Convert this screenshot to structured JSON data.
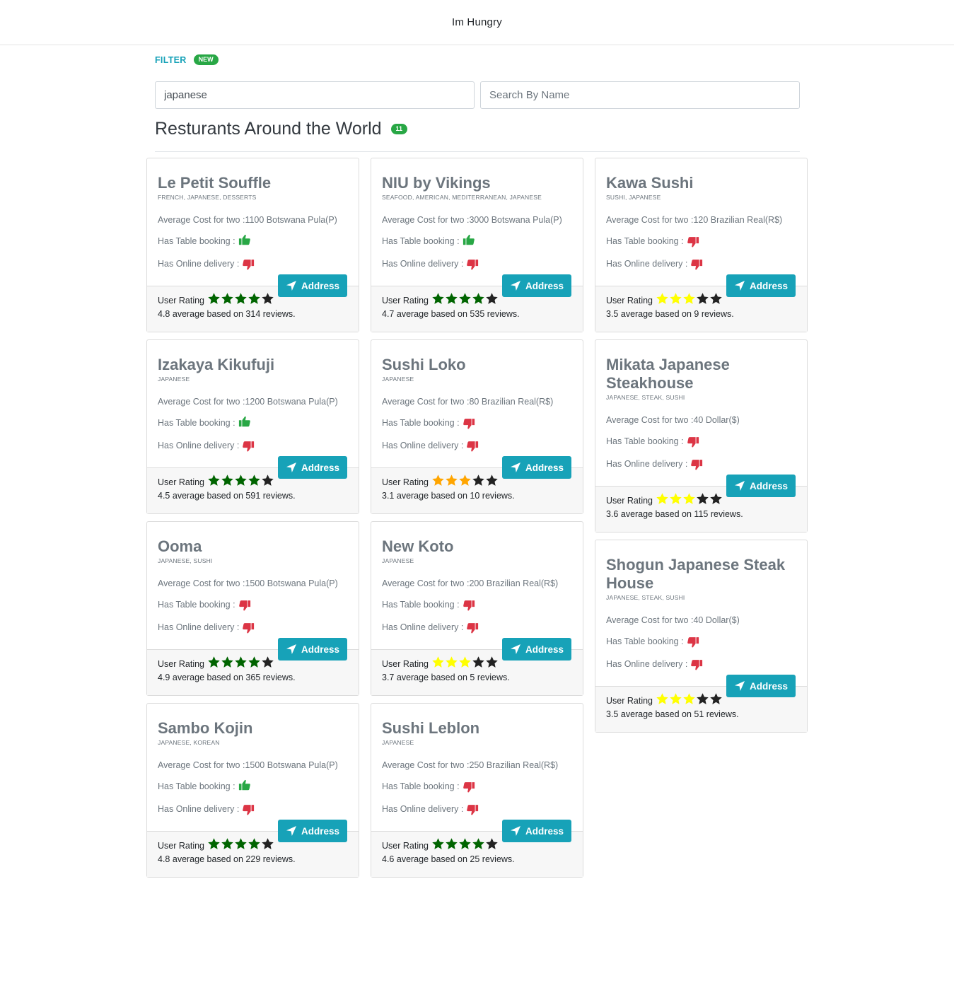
{
  "app": {
    "title": "Im Hungry"
  },
  "filter": {
    "label": "FILTER",
    "badge": "NEW"
  },
  "search": {
    "cuisine_value": "japanese",
    "name_value": "",
    "name_placeholder": "Search By Name"
  },
  "section": {
    "heading": "Resturants Around the World",
    "count": "11"
  },
  "labels": {
    "avg_cost_prefix": "Average Cost for two : ",
    "table_booking": "Has Table booking : ",
    "online_delivery": "Has Online delivery : ",
    "address_button": "Address",
    "user_rating": "User Rating",
    "rating_mid": " average based on ",
    "rating_suffix": " reviews."
  },
  "colors": {
    "accent": "#17a2b8",
    "badge_green": "#28a745",
    "thumb_up": "#28a745",
    "thumb_down": "#dc3545",
    "star_dark_green": "#006400",
    "star_green": "#228b22",
    "star_yellow": "#ffff00",
    "star_orange": "#ffa500",
    "star_empty": "#222222"
  },
  "columns": [
    [
      {
        "name": "Le Petit Souffle",
        "cuisines": "FRENCH, JAPANESE, DESSERTS",
        "cost": "1100 Botswana Pula(P)",
        "table_booking": true,
        "online_delivery": false,
        "rating": 4.8,
        "reviews": 314,
        "star_color": "star_dark_green",
        "filled_stars": 4
      },
      {
        "name": "Izakaya Kikufuji",
        "cuisines": "JAPANESE",
        "cost": "1200 Botswana Pula(P)",
        "table_booking": true,
        "online_delivery": false,
        "rating": 4.5,
        "reviews": 591,
        "star_color": "star_dark_green",
        "filled_stars": 4
      },
      {
        "name": "Ooma",
        "cuisines": "JAPANESE, SUSHI",
        "cost": "1500 Botswana Pula(P)",
        "table_booking": false,
        "online_delivery": false,
        "rating": 4.9,
        "reviews": 365,
        "star_color": "star_dark_green",
        "filled_stars": 4
      },
      {
        "name": "Sambo Kojin",
        "cuisines": "JAPANESE, KOREAN",
        "cost": "1500 Botswana Pula(P)",
        "table_booking": true,
        "online_delivery": false,
        "rating": 4.8,
        "reviews": 229,
        "star_color": "star_dark_green",
        "filled_stars": 4
      }
    ],
    [
      {
        "name": "NIU by Vikings",
        "cuisines": "SEAFOOD, AMERICAN, MEDITERRANEAN, JAPANESE",
        "cost": "3000 Botswana Pula(P)",
        "table_booking": true,
        "online_delivery": false,
        "rating": 4.7,
        "reviews": 535,
        "star_color": "star_dark_green",
        "filled_stars": 4
      },
      {
        "name": "Sushi Loko",
        "cuisines": "JAPANESE",
        "cost": "80 Brazilian Real(R$)",
        "table_booking": false,
        "online_delivery": false,
        "rating": 3.1,
        "reviews": 10,
        "star_color": "star_orange",
        "filled_stars": 3
      },
      {
        "name": "New Koto",
        "cuisines": "JAPANESE",
        "cost": "200 Brazilian Real(R$)",
        "table_booking": false,
        "online_delivery": false,
        "rating": 3.7,
        "reviews": 5,
        "star_color": "star_yellow",
        "filled_stars": 3
      },
      {
        "name": "Sushi Leblon",
        "cuisines": "JAPANESE",
        "cost": "250 Brazilian Real(R$)",
        "table_booking": false,
        "online_delivery": false,
        "rating": 4.6,
        "reviews": 25,
        "star_color": "star_dark_green",
        "filled_stars": 4
      }
    ],
    [
      {
        "name": "Kawa Sushi",
        "cuisines": "SUSHI, JAPANESE",
        "cost": "120 Brazilian Real(R$)",
        "table_booking": false,
        "online_delivery": false,
        "rating": 3.5,
        "reviews": 9,
        "star_color": "star_yellow",
        "filled_stars": 3
      },
      {
        "name": "Mikata Japanese Steakhouse",
        "cuisines": "JAPANESE, STEAK, SUSHI",
        "cost": "40 Dollar($)",
        "table_booking": false,
        "online_delivery": false,
        "rating": 3.6,
        "reviews": 115,
        "star_color": "star_yellow",
        "filled_stars": 3
      },
      {
        "name": "Shogun Japanese Steak House",
        "cuisines": "JAPANESE, STEAK, SUSHI",
        "cost": "40 Dollar($)",
        "table_booking": false,
        "online_delivery": false,
        "rating": 3.5,
        "reviews": 51,
        "star_color": "star_yellow",
        "filled_stars": 3
      }
    ]
  ]
}
